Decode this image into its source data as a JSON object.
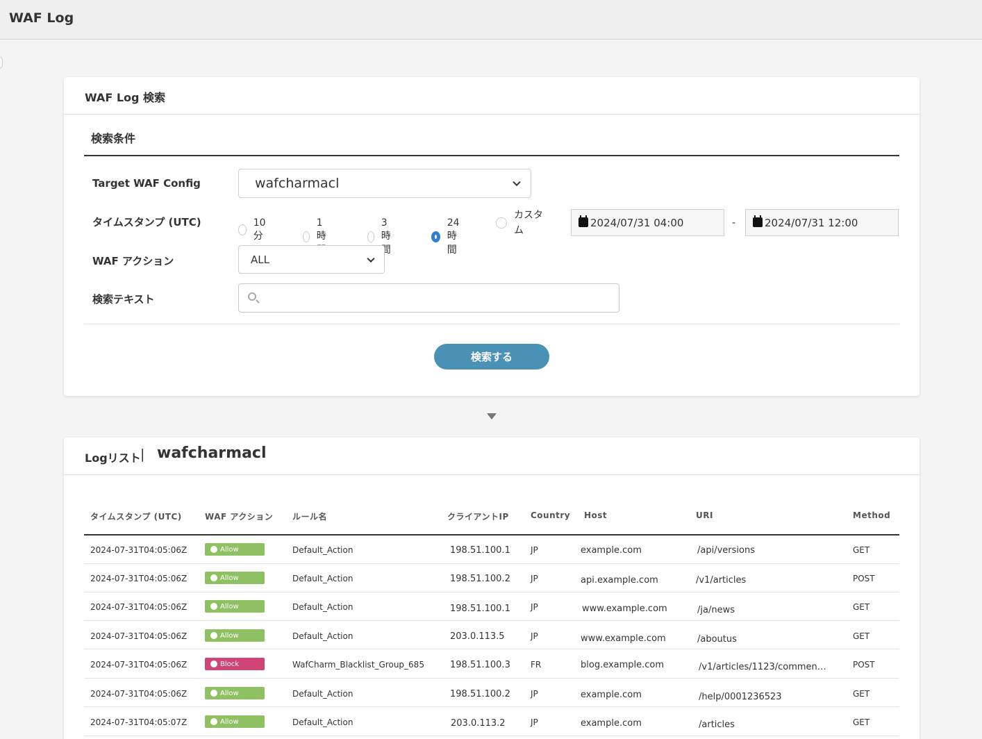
{
  "app": {
    "title": "WAF Log"
  },
  "search_card": {
    "title": "WAF Log 検索",
    "section_title": "検索条件",
    "labels": {
      "target": "Target WAF Config",
      "timestamp": "タイムスタンプ (UTC)",
      "action": "WAF アクション",
      "text": "検索テキスト"
    },
    "target_value": "wafcharmacl",
    "time_options": [
      "10分",
      "1時間",
      "3時間",
      "24時間",
      "カスタ\nム"
    ],
    "time_selected": "24時間",
    "date_from": "2024/07/31 04:00",
    "date_sep": "-",
    "date_to": "2024/07/31 12:00",
    "action_value": "ALL",
    "search_text": "",
    "search_button": "検索する"
  },
  "list_card": {
    "title": "Logリスト",
    "separator": "|",
    "config_name": "wafcharmacl",
    "columns": [
      "タイムスタンプ (UTC)",
      "WAF アクション",
      "ルール名",
      "クライアントIP",
      "Country",
      "Host",
      "URI",
      "Method"
    ],
    "rows": [
      {
        "ts": "2024-07-31T04:05:06Z",
        "action": "Allow",
        "rule": "Default_Action",
        "ip": "198.51.100.1",
        "country": "JP",
        "host": "example.com",
        "uri": "/api/versions",
        "method": "GET"
      },
      {
        "ts": "2024-07-31T04:05:06Z",
        "action": "Allow",
        "rule": "Default_Action",
        "ip": "198.51.100.2",
        "country": "JP",
        "host": "api.example.com",
        "uri": "/v1/articles",
        "method": "POST"
      },
      {
        "ts": "2024-07-31T04:05:06Z",
        "action": "Allow",
        "rule": "Default_Action",
        "ip": "198.51.100.1",
        "country": "JP",
        "host": "www.example.com",
        "uri": "/ja/news",
        "method": "GET"
      },
      {
        "ts": "2024-07-31T04:05:06Z",
        "action": "Allow",
        "rule": "Default_Action",
        "ip": "203.0.113.5",
        "country": "JP",
        "host": "www.example.com",
        "uri": "/aboutus",
        "method": "GET"
      },
      {
        "ts": "2024-07-31T04:05:06Z",
        "action": "Block",
        "rule": "WafCharm_Blacklist_Group_685",
        "ip": "198.51.100.3",
        "country": "FR",
        "host": "blog.example.com",
        "uri": "/v1/articles/1123/commen…",
        "method": "POST"
      },
      {
        "ts": "2024-07-31T04:05:06Z",
        "action": "Allow",
        "rule": "Default_Action",
        "ip": "198.51.100.2",
        "country": "JP",
        "host": "example.com",
        "uri": "/help/0001236523",
        "method": "GET"
      },
      {
        "ts": "2024-07-31T04:05:07Z",
        "action": "Allow",
        "rule": "Default_Action",
        "ip": "203.0.113.2",
        "country": "JP",
        "host": "example.com",
        "uri": "/articles",
        "method": "GET"
      }
    ]
  },
  "colors": {
    "allow": "#8fc163",
    "block": "#d14476",
    "primary_button": "#4a92b5",
    "radio_checked": "#2f7fd6"
  },
  "icons": {
    "calendar": "calendar-icon",
    "search": "search-icon",
    "chevron": "chevron-down-icon"
  }
}
